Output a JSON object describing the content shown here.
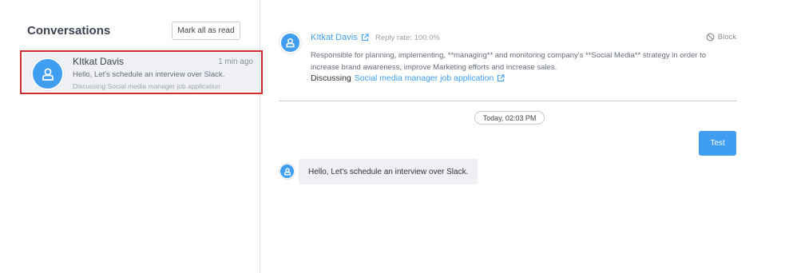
{
  "sidebar": {
    "title": "Conversations",
    "mark_all_label": "Mark all as read",
    "conversations": [
      {
        "name": "KItkat Davis",
        "time": "1 min ago",
        "preview": "Hello, Let's schedule an interview over Slack.",
        "subject": "Discussing Social media manager job application",
        "avatar_icon": "user-icon"
      }
    ]
  },
  "header": {
    "name": "KItkat Davis",
    "reply_rate": "Reply rate: 100.0%",
    "block_label": "Block",
    "description": "Responsible for planning, implementing, **managing** and monitoring company's **Social Media** strategy in order to increase brand awareness, improve Marketing efforts and increase sales.",
    "discussing_label": "Discussing",
    "job_link": "Social media manager job application"
  },
  "chat": {
    "date_label": "Today, 02:03 PM",
    "sent_message": "Test",
    "received_message": "Hello, Let's schedule an interview over Slack."
  },
  "colors": {
    "accent": "#3f9ef0",
    "highlight_border": "#d12b30",
    "selected_bg": "#f0f1f4"
  }
}
